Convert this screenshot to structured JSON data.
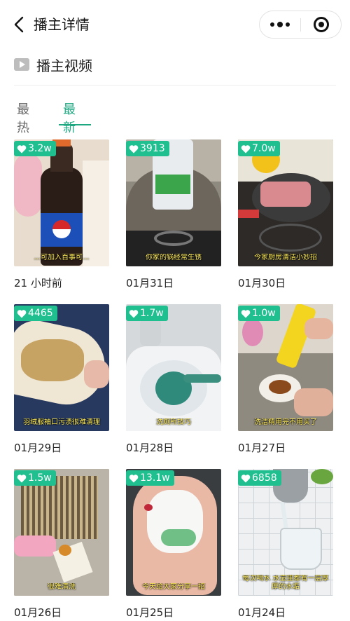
{
  "nav": {
    "title": "播主详情"
  },
  "section": {
    "title": "播主视频"
  },
  "tabs": [
    {
      "label": "最热",
      "active": false
    },
    {
      "label": "最新",
      "active": true
    }
  ],
  "colors": {
    "accent": "#1ea882",
    "badge": "#1fbf8f",
    "caption": "#ffec5c"
  },
  "videos": [
    {
      "likes": "3.2w",
      "caption": "...可加入百事可...",
      "date": "21 小时前"
    },
    {
      "likes": "3913",
      "caption": "你家的锅经常生锈",
      "date": "01月31日"
    },
    {
      "likes": "7.0w",
      "caption": "今家厨房清洁小妙招",
      "date": "01月30日"
    },
    {
      "likes": "4465",
      "caption": "羽绒服袖口污渍很难清理",
      "date": "01月29日"
    },
    {
      "likes": "1.7w",
      "caption": "洗厕所技巧",
      "date": "01月28日"
    },
    {
      "likes": "1.0w",
      "caption": "洗洁精用完不用买了",
      "date": "01月27日"
    },
    {
      "likes": "1.5w",
      "caption": "很难清洗",
      "date": "01月26日"
    },
    {
      "likes": "13.1w",
      "caption": "今天给大家分享一招",
      "date": "01月25日"
    },
    {
      "likes": "6858",
      "caption": "每次喝水 水壶里都有一层厚厚的水垢",
      "date": "01月24日"
    }
  ]
}
